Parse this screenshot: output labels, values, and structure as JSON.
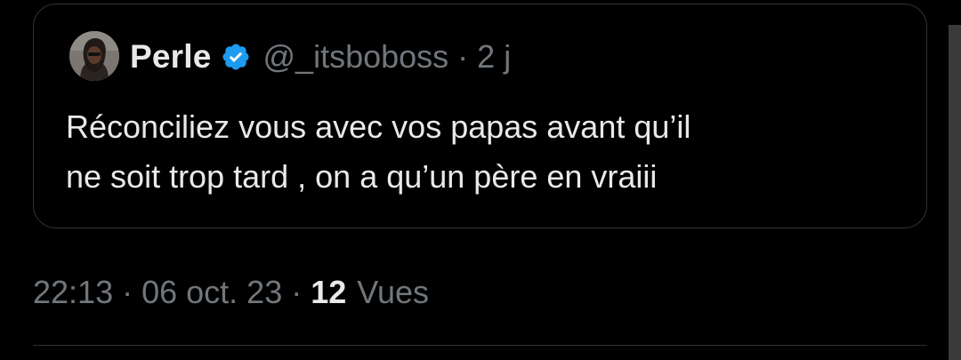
{
  "quoted_tweet": {
    "author": {
      "display_name": "Perle",
      "verified": true,
      "verified_icon": "verified-badge-icon",
      "handle": "@_itsboboss"
    },
    "separator": "·",
    "age": "2 j",
    "text": "Réconciliez vous avec vos papas avant qu’il\nne soit trop tard , on a qu’un père en vraiii"
  },
  "tweet_meta": {
    "time": "22:13",
    "separator": "·",
    "date": "06 oct. 23",
    "views_count": "12",
    "views_label": "Vues"
  },
  "colors": {
    "background": "#000000",
    "text_primary": "#e7e9ea",
    "text_secondary": "#71767b",
    "border": "#2f3336",
    "verified_blue": "#1d9bf0"
  }
}
